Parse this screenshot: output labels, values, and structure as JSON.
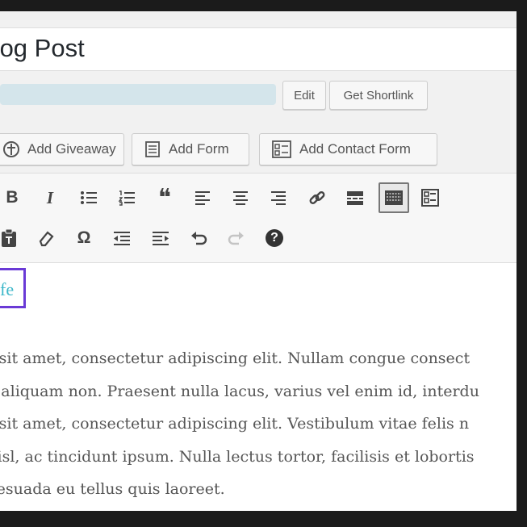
{
  "title": {
    "text": "Blog Post"
  },
  "permalink": {
    "edit_label": "Edit",
    "shortlink_label": "Get Shortlink"
  },
  "media_buttons": [
    {
      "label": "Add Giveaway",
      "icon": "gift-icon"
    },
    {
      "label": "Add Form",
      "icon": "form-icon"
    },
    {
      "label": "Add Contact Form",
      "icon": "contact-form-icon"
    }
  ],
  "toolbar": {
    "row1": [
      "bold-icon",
      "italic-icon",
      "bulleted-list-icon",
      "numbered-list-icon",
      "blockquote-icon",
      "align-left-icon",
      "align-center-icon",
      "align-right-icon",
      "link-icon",
      "read-more-icon",
      "toolbar-toggle-icon",
      "form-builder-icon"
    ],
    "row2": [
      "paste-text-icon",
      "clear-formatting-icon",
      "special-character-icon",
      "outdent-icon",
      "indent-icon",
      "undo-icon",
      "redo-icon",
      "help-icon"
    ],
    "bold": "B",
    "italic": "I",
    "omega": "Ω",
    "quote": "❝",
    "help": "?"
  },
  "content": {
    "heading_text": "fe",
    "paragraph_lines": [
      "lor sit amet, consectetur adipiscing elit. Nullam congue consect",
      "em aliquam non. Praesent nulla lacus, varius vel enim id, interdu",
      "lor sit amet, consectetur adipiscing elit. Vestibulum vitae felis n",
      "n nisl, ac tincidunt ipsum. Nulla lectus tortor, facilisis et lobortis",
      "nalesuada eu tellus quis laoreet."
    ]
  }
}
